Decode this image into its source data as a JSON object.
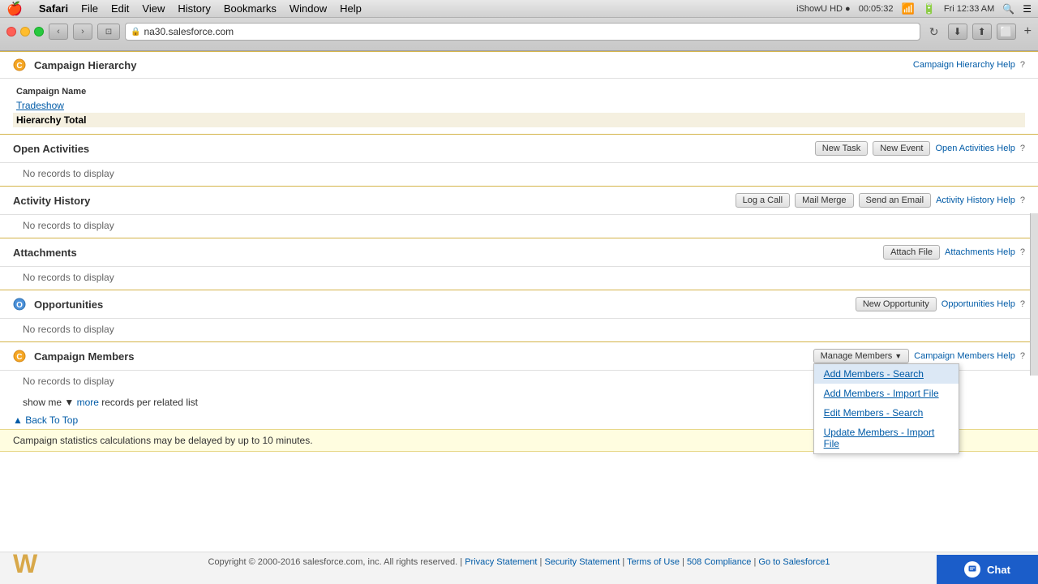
{
  "macbar": {
    "apple": "🍎",
    "items": [
      "Safari",
      "File",
      "Edit",
      "View",
      "History",
      "Bookmarks",
      "Window",
      "Help"
    ],
    "bold_item": "Safari",
    "right": {
      "ishowu": "iShowU HD ●",
      "time_label": "00:05:32",
      "clock": "Fri 12:33 AM",
      "search_icon": "🔍",
      "menu_icon": "☰"
    }
  },
  "browser": {
    "url": "na30.salesforce.com",
    "nav_back": "‹",
    "nav_forward": "›",
    "tab_icon": "⊡",
    "refresh": "↻",
    "icons": [
      "⬇",
      "⬆",
      "⬜",
      "+"
    ]
  },
  "campaign_hierarchy": {
    "title": "Campaign Hierarchy",
    "help_link": "Campaign Hierarchy Help",
    "col_campaign_name": "Campaign Name",
    "row_tradeshow": "Tradeshow",
    "row_hierarchy_total": "Hierarchy Total"
  },
  "open_activities": {
    "title": "Open Activities",
    "btn_new_task": "New Task",
    "btn_new_event": "New Event",
    "help_link": "Open Activities Help",
    "no_records": "No records to display"
  },
  "activity_history": {
    "title": "Activity History",
    "btn_log_call": "Log a Call",
    "btn_mail_merge": "Mail Merge",
    "btn_send_email": "Send an Email",
    "help_link": "Activity History Help",
    "no_records": "No records to display"
  },
  "attachments": {
    "title": "Attachments",
    "btn_attach_file": "Attach File",
    "help_link": "Attachments Help",
    "no_records": "No records to display"
  },
  "opportunities": {
    "title": "Opportunities",
    "btn_new_opportunity": "New Opportunity",
    "help_link": "Opportunities Help",
    "no_records": "No records to display"
  },
  "campaign_members": {
    "title": "Campaign Members",
    "btn_manage_members": "Manage Members",
    "help_link": "Campaign Members Help",
    "no_records": "No records to display",
    "show_me": "show me",
    "more": "more",
    "records_per_related_list": "records per related list"
  },
  "manage_members_dropdown": {
    "items": [
      "Add Members - Search",
      "Add Members - Import File",
      "Edit Members - Search",
      "Update Members - Import File"
    ],
    "highlighted_index": 0
  },
  "footer_nav": {
    "back_to_top": "Back To Top",
    "warning": "Campaign statistics calculations may be delayed by up to 10 minutes.",
    "copyright": "Copyright © 2000-2016 salesforce.com, inc. All rights reserved.",
    "links": [
      "Privacy Statement",
      "Security Statement",
      "Terms of Use",
      "508 Compliance",
      "Go to Salesforce1"
    ]
  },
  "chat": {
    "label": "Chat"
  }
}
